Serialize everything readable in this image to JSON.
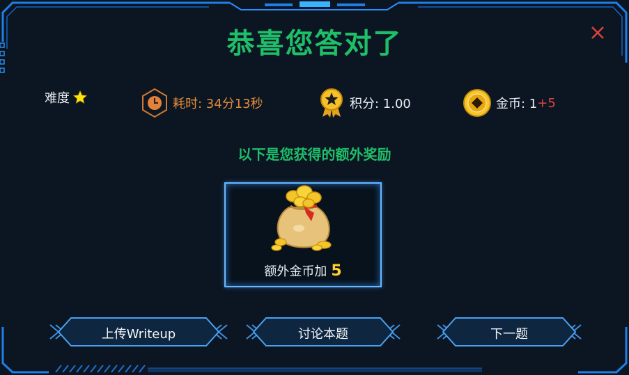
{
  "modal": {
    "title": "恭喜您答对了",
    "close_icon": "close-icon",
    "subtitle": "以下是您获得的额外奖励"
  },
  "stats": {
    "difficulty_label": "难度",
    "difficulty_stars": 1,
    "time_label": "耗时: 34分13秒",
    "score_label": "积分: 1.00",
    "coins_label": "金币: 1",
    "coins_bonus": "+5"
  },
  "reward": {
    "icon": "coin-bag-icon",
    "text": "额外金币加",
    "amount": "5"
  },
  "buttons": {
    "upload": "上传Writeup",
    "discuss": "讨论本题",
    "next": "下一题"
  },
  "colors": {
    "accent_green": "#1fbf6a",
    "frame_blue": "#1f7fe6",
    "time_orange": "#e28b3b",
    "bonus_red": "#e8423f",
    "coin_gold": "#ffd12a"
  }
}
